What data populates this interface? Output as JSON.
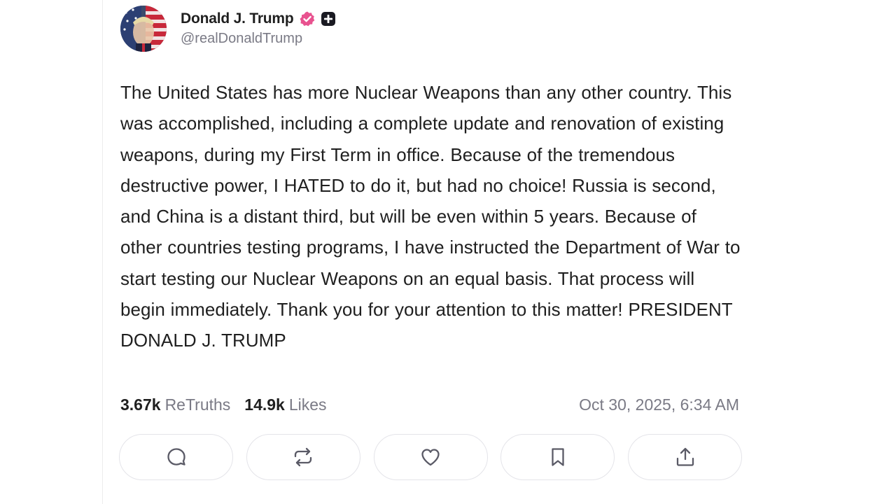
{
  "author": {
    "display_name": "Donald J. Trump",
    "handle": "@realDonaldTrump",
    "avatar_icon": "avatar-image",
    "verified_icon": "verified-badge-icon",
    "verified_color": "#e8528f",
    "plus_icon": "plus-badge-icon"
  },
  "post": {
    "text": "The United States has more Nuclear Weapons than any other country. This was accomplished, including a complete update and renovation of existing weapons, during my First Term in office. Because of the tremendous destructive power, I HATED to do it, but had no choice! Russia is second, and China is a distant third, but will be even within 5 years. Because of other countries testing programs, I have instructed the Department of War to start testing our Nuclear Weapons on an equal basis. That process will begin immediately. Thank you for your attention to this matter! PRESIDENT DONALD J. TRUMP"
  },
  "stats": {
    "retruths_count": "3.67k",
    "retruths_label": "ReTruths",
    "likes_count": "14.9k",
    "likes_label": "Likes",
    "timestamp": "Oct 30, 2025, 6:34 AM"
  },
  "actions": [
    {
      "name": "reply-button",
      "icon": "comment-icon"
    },
    {
      "name": "retruth-button",
      "icon": "repost-icon"
    },
    {
      "name": "like-button",
      "icon": "heart-icon"
    },
    {
      "name": "bookmark-button",
      "icon": "bookmark-icon"
    },
    {
      "name": "share-button",
      "icon": "share-icon"
    }
  ],
  "colors": {
    "text": "#1f1f1f",
    "muted": "#7a7a85",
    "border": "#e4e4e9",
    "verified": "#e8528f"
  }
}
